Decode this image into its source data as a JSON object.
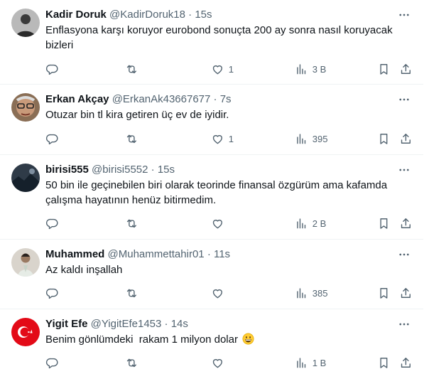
{
  "tweets": [
    {
      "name": "Kadir Doruk",
      "handle": "@KadirDoruk18",
      "sep": "·",
      "time": "15s",
      "text": "Enflasyona karşı koruyor eurobond sonuçta 200 ay sonra nasıl koruyacak bizleri",
      "likes": "1",
      "views": "3 B",
      "avatar_icon": "user-avatar-dark"
    },
    {
      "name": "Erkan Akçay",
      "handle": "@ErkanAk43667677",
      "sep": "·",
      "time": "7s",
      "text": "Otuzar bin tl kira getiren üç ev de iyidir.",
      "likes": "1",
      "views": "395",
      "avatar_icon": "user-avatar-glasses"
    },
    {
      "name": "birisi555",
      "handle": "@birisi5552",
      "sep": "·",
      "time": "15s",
      "text_line1": "50 bin ile geçinebilen biri olarak teorinde finansal özgürüm ama kafamda",
      "text_line2": "çalışma hayatının henüz bitirmedim.",
      "likes": "",
      "views": "2 B",
      "avatar_icon": "user-avatar-landscape"
    },
    {
      "name": "Muhammed",
      "handle": "@Muhammettahir01",
      "sep": "·",
      "time": "11s",
      "text": "Az kaldı inşallah",
      "likes": "",
      "views": "385",
      "avatar_icon": "user-avatar-person"
    },
    {
      "name": "Yigit Efe",
      "handle": "@YigitEfe1453",
      "sep": "·",
      "time": "14s",
      "text": "Benim gönlümdeki  rakam 1 milyon dolar",
      "emoji": "grinning-face-emoji",
      "likes": "",
      "views": "1 B",
      "avatar_icon": "turkish-flag-avatar"
    }
  ],
  "colors": {
    "text": "#0f1419",
    "secondary": "#536471",
    "divider": "#eff3f4",
    "flag_red": "#e30a17"
  }
}
